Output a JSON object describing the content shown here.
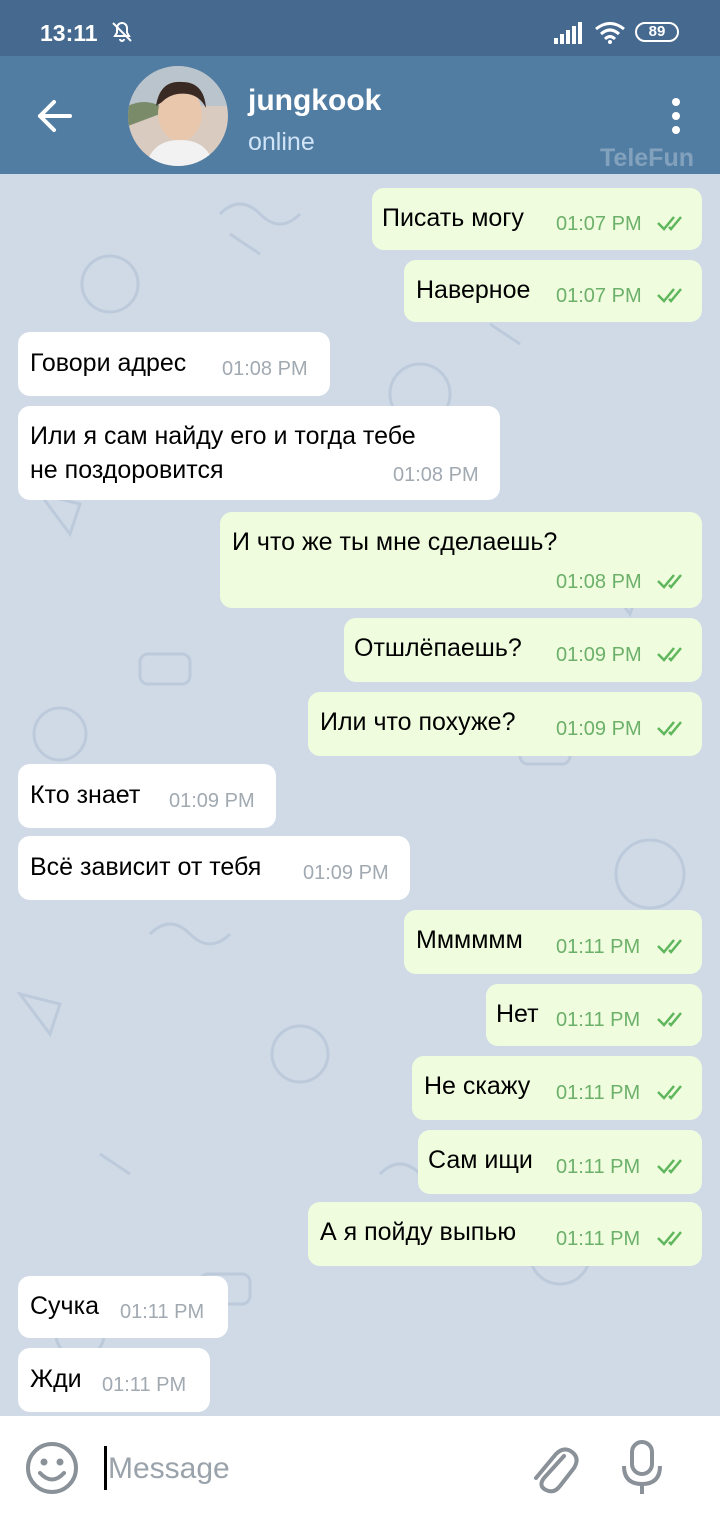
{
  "status_bar": {
    "time": "13:11",
    "battery": "89"
  },
  "header": {
    "contact_name": "jungkook",
    "contact_status": "online",
    "watermark": "TeleFun"
  },
  "messages": [
    {
      "dir": "out",
      "text": "Писать могу",
      "time": "01:07 PM"
    },
    {
      "dir": "out",
      "text": "Наверное",
      "time": "01:07 PM"
    },
    {
      "dir": "in",
      "text": "Говори адрес",
      "time": "01:08 PM"
    },
    {
      "dir": "in",
      "text": "Или я сам найду его и тогда тебе",
      "text2": "не поздоровится",
      "time": "01:08 PM"
    },
    {
      "dir": "out",
      "text": "И что же ты мне сделаешь?",
      "time": "01:08 PM"
    },
    {
      "dir": "out",
      "text": "Отшлёпаешь?",
      "time": "01:09 PM"
    },
    {
      "dir": "out",
      "text": "Или что похуже?",
      "time": "01:09 PM"
    },
    {
      "dir": "in",
      "text": "Кто знает",
      "time": "01:09 PM"
    },
    {
      "dir": "in",
      "text": "Всё зависит от тебя",
      "time": "01:09 PM"
    },
    {
      "dir": "out",
      "text": "Мммммм",
      "time": "01:11 PM"
    },
    {
      "dir": "out",
      "text": "Нет",
      "time": "01:11 PM"
    },
    {
      "dir": "out",
      "text": "Не скажу",
      "time": "01:11 PM"
    },
    {
      "dir": "out",
      "text": "Сам ищи",
      "time": "01:11 PM"
    },
    {
      "dir": "out",
      "text": "А я пойду выпью",
      "time": "01:11 PM"
    },
    {
      "dir": "in",
      "text": "Сучка",
      "time": "01:11 PM"
    },
    {
      "dir": "in",
      "text": "Жди",
      "time": "01:11 PM"
    }
  ],
  "input": {
    "placeholder": "Message"
  },
  "icons": {
    "back": "arrow-left-icon",
    "menu": "more-vertical-icon",
    "emoji": "smiley-icon",
    "attach": "paperclip-icon",
    "mic": "microphone-icon",
    "read_receipt": "double-check-icon"
  },
  "colors": {
    "header": "#527da3",
    "status_bar": "#46698f",
    "outgoing_bubble": "#effdde",
    "incoming_bubble": "#ffffff",
    "time_out": "#6cb06a",
    "time_in": "#a1a9b1",
    "chat_bg": "#cfdae6"
  }
}
